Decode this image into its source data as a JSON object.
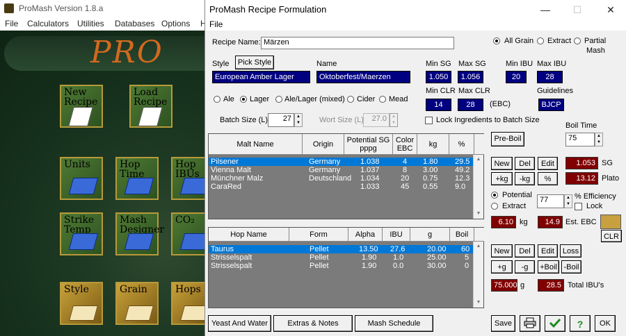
{
  "main_app": {
    "title": "ProMash Version 1.8.a",
    "menu": [
      "File",
      "Calculators",
      "Utilities",
      "Databases",
      "Options",
      "H"
    ],
    "logo_text": "PRO",
    "tiles": [
      {
        "label1": "New",
        "label2": "Recipe"
      },
      {
        "label1": "Load",
        "label2": "Recipe"
      },
      {
        "label1": "Units",
        "label2": ""
      },
      {
        "label1": "Hop",
        "label2": "Time"
      },
      {
        "label1": "Hop",
        "label2": "IBUs"
      },
      {
        "label1": "Strike",
        "label2": "Temp"
      },
      {
        "label1": "Mash",
        "label2": "Designer"
      },
      {
        "label1": "CO₂",
        "label2": ""
      },
      {
        "label1": "Style",
        "label2": ""
      },
      {
        "label1": "Grain",
        "label2": ""
      },
      {
        "label1": "Hops",
        "label2": ""
      }
    ]
  },
  "dialog": {
    "title": "ProMash Recipe Formulation",
    "menu_file": "File",
    "window_buttons": {
      "minimize": "—",
      "maximize": "☐",
      "close": "✕"
    },
    "recipe_name_label": "Recipe Name:",
    "recipe_name_value": "Märzen",
    "grain_type": {
      "all_grain": "All Grain",
      "extract": "Extract",
      "partial": "Partial",
      "partial2": "Mash",
      "selected": "all_grain"
    },
    "style_label": "Style",
    "pick_style_button": "Pick Style",
    "name_label": "Name",
    "style_value": "European Amber Lager",
    "name_value": "Oktoberfest/Maerzen",
    "min_sg_label": "Min SG",
    "min_sg": "1.050",
    "max_sg_label": "Max SG",
    "max_sg": "1.056",
    "min_ibu_label": "Min IBU",
    "min_ibu": "20",
    "max_ibu_label": "Max IBU",
    "max_ibu": "28",
    "min_clr_label": "Min CLR",
    "min_clr": "14",
    "max_clr_label": "Max CLR",
    "max_clr": "28",
    "ebc_label": "(EBC)",
    "guidelines_label": "Guidelines",
    "guidelines": "BJCP",
    "beer_types": [
      "Ale",
      "Lager",
      "Ale/Lager (mixed)",
      "Cider",
      "Mead"
    ],
    "beer_type_selected": "Lager",
    "batch_size_label": "Batch Size (L)",
    "batch_size": "27",
    "wort_size_label": "Wort Size (L)",
    "wort_size": "27.0",
    "lock_ingredients_label": "Lock Ingredients to Batch Size",
    "boil_time_label": "Boil Time",
    "boil_time": "75",
    "pre_boil_button": "Pre-Boil",
    "malt_columns": [
      "Malt Name",
      "Origin",
      "Potential SG pppg",
      "Color EBC",
      "kg",
      "%"
    ],
    "malts": [
      {
        "name": "Pilsener",
        "origin": "Germany",
        "sg": "1.038",
        "color": "4",
        "kg": "1.80",
        "pct": "29.5"
      },
      {
        "name": "Vienna Malt",
        "origin": "Germany",
        "sg": "1.037",
        "color": "8",
        "kg": "3.00",
        "pct": "49.2"
      },
      {
        "name": "Münchner Malz",
        "origin": "Deutschland",
        "sg": "1.034",
        "color": "20",
        "kg": "0.75",
        "pct": "12.3"
      },
      {
        "name": "CaraRed",
        "origin": "",
        "sg": "1.033",
        "color": "45",
        "kg": "0.55",
        "pct": "9.0"
      }
    ],
    "malt_buttons": {
      "new": "New",
      "del": "Del",
      "edit": "Edit",
      "pluskg": "+kg",
      "minuskg": "-kg",
      "pct": "%"
    },
    "sg_value": "1.053",
    "sg_label": "SG",
    "plato_value": "13.12",
    "plato_label": "Plato",
    "potential_label": "Potential",
    "extract_label": "Extract",
    "efficiency_value": "77",
    "efficiency_label": "% Efficiency",
    "lock_label": "Lock",
    "total_kg": "6.10",
    "kg_label": "kg",
    "est_ebc": "14.9",
    "est_ebc_label": "Est. EBC",
    "clr_button": "CLR",
    "hop_columns": [
      "Hop Name",
      "Form",
      "Alpha",
      "IBU",
      "g",
      "Boil"
    ],
    "hops": [
      {
        "name": "Taurus",
        "form": "Pellet",
        "alpha": "13.50",
        "ibu": "27.6",
        "g": "20.00",
        "boil": "60"
      },
      {
        "name": "Strisselspalt",
        "form": "Pellet",
        "alpha": "1.90",
        "ibu": "1.0",
        "g": "25.00",
        "boil": "5"
      },
      {
        "name": "Strisselspalt",
        "form": "Pellet",
        "alpha": "1.90",
        "ibu": "0.0",
        "g": "30.00",
        "boil": "0"
      }
    ],
    "hop_buttons": {
      "new": "New",
      "del": "Del",
      "edit": "Edit",
      "loss": "Loss",
      "plusg": "+g",
      "minusg": "-g",
      "plusboil": "+Boil",
      "minusboil": "-Boil"
    },
    "total_g": "75.000",
    "g_label": "g",
    "total_ibu": "28.5",
    "total_ibu_label": "Total IBU's",
    "bottom_buttons": {
      "yeast": "Yeast And Water",
      "extras": "Extras & Notes",
      "mash": "Mash Schedule"
    },
    "save_button": "Save",
    "ok_button": "OK",
    "help_glyph": "?"
  }
}
